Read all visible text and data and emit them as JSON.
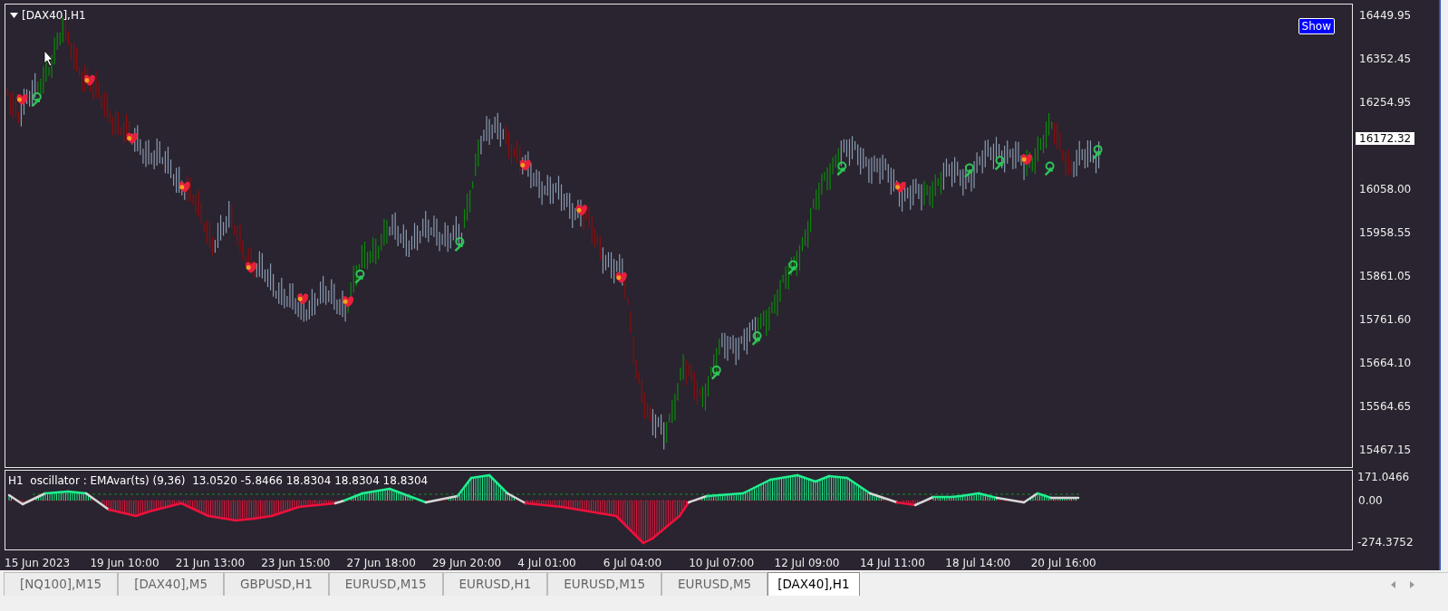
{
  "chart": {
    "title": "[DAX40],H1",
    "show_button": "Show"
  },
  "price_axis": {
    "labels": [
      "16449.95",
      "16352.45",
      "16254.95",
      "16058.00",
      "15958.55",
      "15861.05",
      "15761.60",
      "15664.10",
      "15564.65",
      "15467.15"
    ],
    "current_price": "16172.32"
  },
  "oscillator": {
    "header": "H1  oscillator : EMAvar(ts) (9,36)  13.0520 -5.8466 18.8304 18.8304 18.8304",
    "axis_labels": [
      "171.0466",
      "0.00",
      "-274.3752"
    ]
  },
  "time_axis": {
    "labels": [
      "15 Jun 2023",
      "19 Jun 10:00",
      "21 Jun 13:00",
      "23 Jun 15:00",
      "27 Jun 18:00",
      "29 Jun 20:00",
      "4 Jul 01:00",
      "6 Jul 04:00",
      "10 Jul 07:00",
      "12 Jul 09:00",
      "14 Jul 11:00",
      "18 Jul 14:00",
      "20 Jul 16:00"
    ]
  },
  "tabs": [
    {
      "label": "[NQ100],M15",
      "selected": false
    },
    {
      "label": "[DAX40],M5",
      "selected": false
    },
    {
      "label": "GBPUSD,H1",
      "selected": false
    },
    {
      "label": "EURUSD,M15",
      "selected": false
    },
    {
      "label": "EURUSD,H1",
      "selected": false
    },
    {
      "label": "EURUSD,M15",
      "selected": false
    },
    {
      "label": "EURUSD,M5",
      "selected": false
    },
    {
      "label": "[DAX40],H1",
      "selected": true
    }
  ]
}
